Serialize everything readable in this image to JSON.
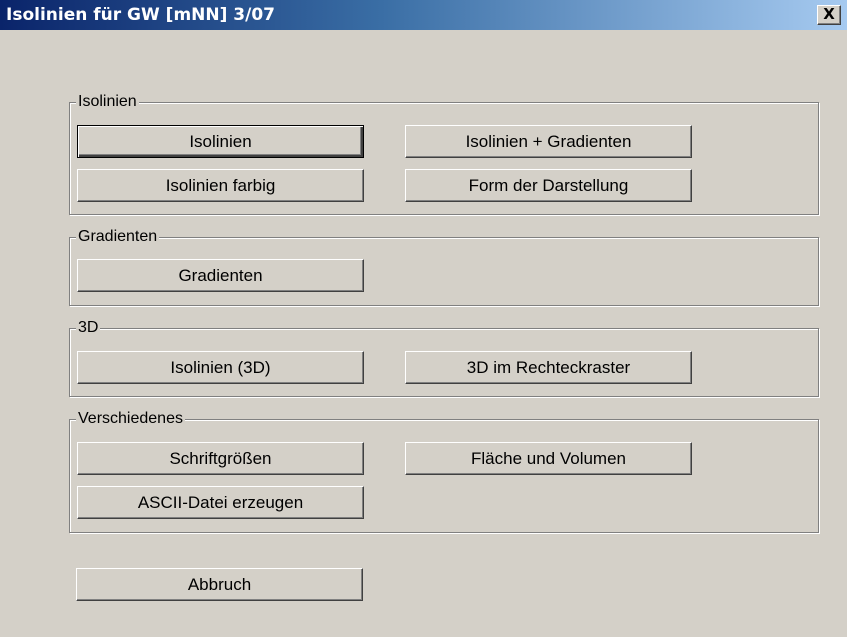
{
  "window": {
    "title": "Isolinien für GW [mNN] 3/07",
    "close_label": "X"
  },
  "groups": {
    "isolinien": {
      "label": "Isolinien",
      "buttons": [
        "Isolinien",
        "Isolinien + Gradienten",
        "Isolinien farbig",
        "Form der Darstellung"
      ]
    },
    "gradienten": {
      "label": "Gradienten",
      "buttons": [
        "Gradienten"
      ]
    },
    "three_d": {
      "label": "3D",
      "buttons": [
        "Isolinien (3D)",
        "3D im Rechteckraster"
      ]
    },
    "verschiedenes": {
      "label": "Verschiedenes",
      "buttons": [
        "Schriftgrößen",
        "Fläche und Volumen",
        "ASCII-Datei erzeugen"
      ]
    }
  },
  "abbruch_label": "Abbruch"
}
